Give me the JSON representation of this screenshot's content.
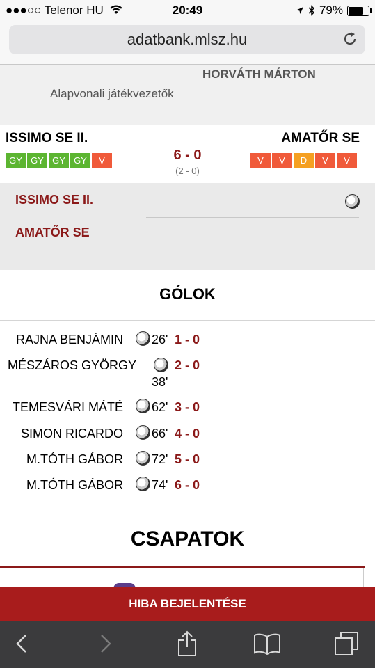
{
  "status_bar": {
    "carrier": "●●●○○ Telenor HU",
    "time": "20:49",
    "battery": "79%",
    "battery_level": 0.79,
    "icons": [
      "wifi-icon",
      "location-arrow-icon",
      "bluetooth-icon",
      "battery-icon"
    ]
  },
  "browser": {
    "url": "adatbank.mlsz.hu",
    "reload_icon": "reload-icon"
  },
  "referee": {
    "name": "HORVÁTH MÁRTON",
    "label": "Alapvonali játékvezetők"
  },
  "match": {
    "home_team": "ISSIMO SE II.",
    "away_team": "AMATŐR SE",
    "score": "6 - 0",
    "halftime": "(2 - 0)",
    "home_form": [
      {
        "label": "GY",
        "type": "win"
      },
      {
        "label": "GY",
        "type": "win"
      },
      {
        "label": "GY",
        "type": "win"
      },
      {
        "label": "GY",
        "type": "win"
      },
      {
        "label": "V",
        "type": "loss"
      }
    ],
    "away_form": [
      {
        "label": "V",
        "type": "loss"
      },
      {
        "label": "V",
        "type": "loss"
      },
      {
        "label": "D",
        "type": "draw"
      },
      {
        "label": "V",
        "type": "loss"
      },
      {
        "label": "V",
        "type": "loss"
      }
    ]
  },
  "timeline": {
    "home_team": "ISSIMO SE II.",
    "away_team": "AMATŐR SE"
  },
  "goals": {
    "title": "GÓLOK",
    "items": [
      {
        "player": "RAJNA BENJÁMIN",
        "minute": "26'",
        "score": "1 - 0"
      },
      {
        "player": "MÉSZÁROS GYÖRGY",
        "minute": "38'",
        "score": "2 - 0"
      },
      {
        "player": "TEMESVÁRI MÁTÉ",
        "minute": "62'",
        "score": "3 - 0"
      },
      {
        "player": "SIMON RICARDO",
        "minute": "66'",
        "score": "4 - 0"
      },
      {
        "player": "M.TÓTH GÁBOR",
        "minute": "72'",
        "score": "5 - 0"
      },
      {
        "player": "M.TÓTH GÁBOR",
        "minute": "74'",
        "score": "6 - 0"
      }
    ]
  },
  "teams_section": {
    "title": "CSAPATOK"
  },
  "report_button": {
    "label": "HIBA BEJELENTÉSE"
  },
  "colors": {
    "win": "#5cb531",
    "loss": "#f05a3a",
    "draw": "#f5a022",
    "accent": "#8b1919",
    "report_bg": "#a81c1c"
  }
}
